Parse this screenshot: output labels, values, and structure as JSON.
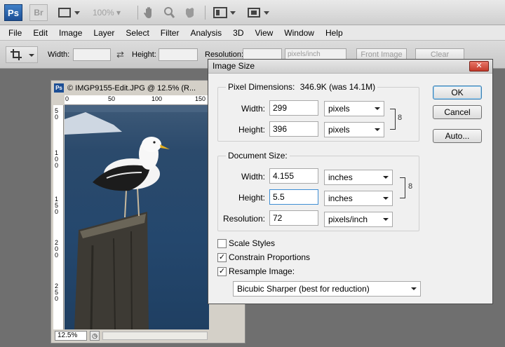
{
  "appbar": {
    "ps_logo": "Ps",
    "br_logo": "Br",
    "zoom_level": "100%"
  },
  "menubar": {
    "items": [
      "File",
      "Edit",
      "Image",
      "Layer",
      "Select",
      "Filter",
      "Analysis",
      "3D",
      "View",
      "Window",
      "Help"
    ]
  },
  "options": {
    "width_label": "Width:",
    "height_label": "Height:",
    "resolution_label": "Resolution:",
    "resolution_unit": "pixels/inch",
    "front_image": "Front Image",
    "clear": "Clear"
  },
  "document": {
    "title": "© IMGP9155-Edit.JPG @ 12.5% (R...",
    "ruler_h": [
      "0",
      "50",
      "100",
      "150"
    ],
    "ruler_v": [
      "5 0",
      "1 0 0",
      "1 5 0",
      "2 0 0",
      "2 5 0"
    ],
    "zoom": "12.5%"
  },
  "dialog": {
    "title": "Image Size",
    "pixel_dimensions": {
      "label": "Pixel Dimensions:",
      "summary": "346.9K (was 14.1M)",
      "width_label": "Width:",
      "width_value": "299",
      "width_unit": "pixels",
      "height_label": "Height:",
      "height_value": "396",
      "height_unit": "pixels"
    },
    "document_size": {
      "label": "Document Size:",
      "width_label": "Width:",
      "width_value": "4.155",
      "width_unit": "inches",
      "height_label": "Height:",
      "height_value": "5.5",
      "height_unit": "inches",
      "resolution_label": "Resolution:",
      "resolution_value": "72",
      "resolution_unit": "pixels/inch"
    },
    "scale_styles": "Scale Styles",
    "scale_styles_checked": false,
    "constrain_proportions": "Constrain Proportions",
    "constrain_checked": true,
    "resample_image": "Resample Image:",
    "resample_checked": true,
    "resample_method": "Bicubic Sharper (best for reduction)",
    "ok": "OK",
    "cancel": "Cancel",
    "auto": "Auto..."
  }
}
